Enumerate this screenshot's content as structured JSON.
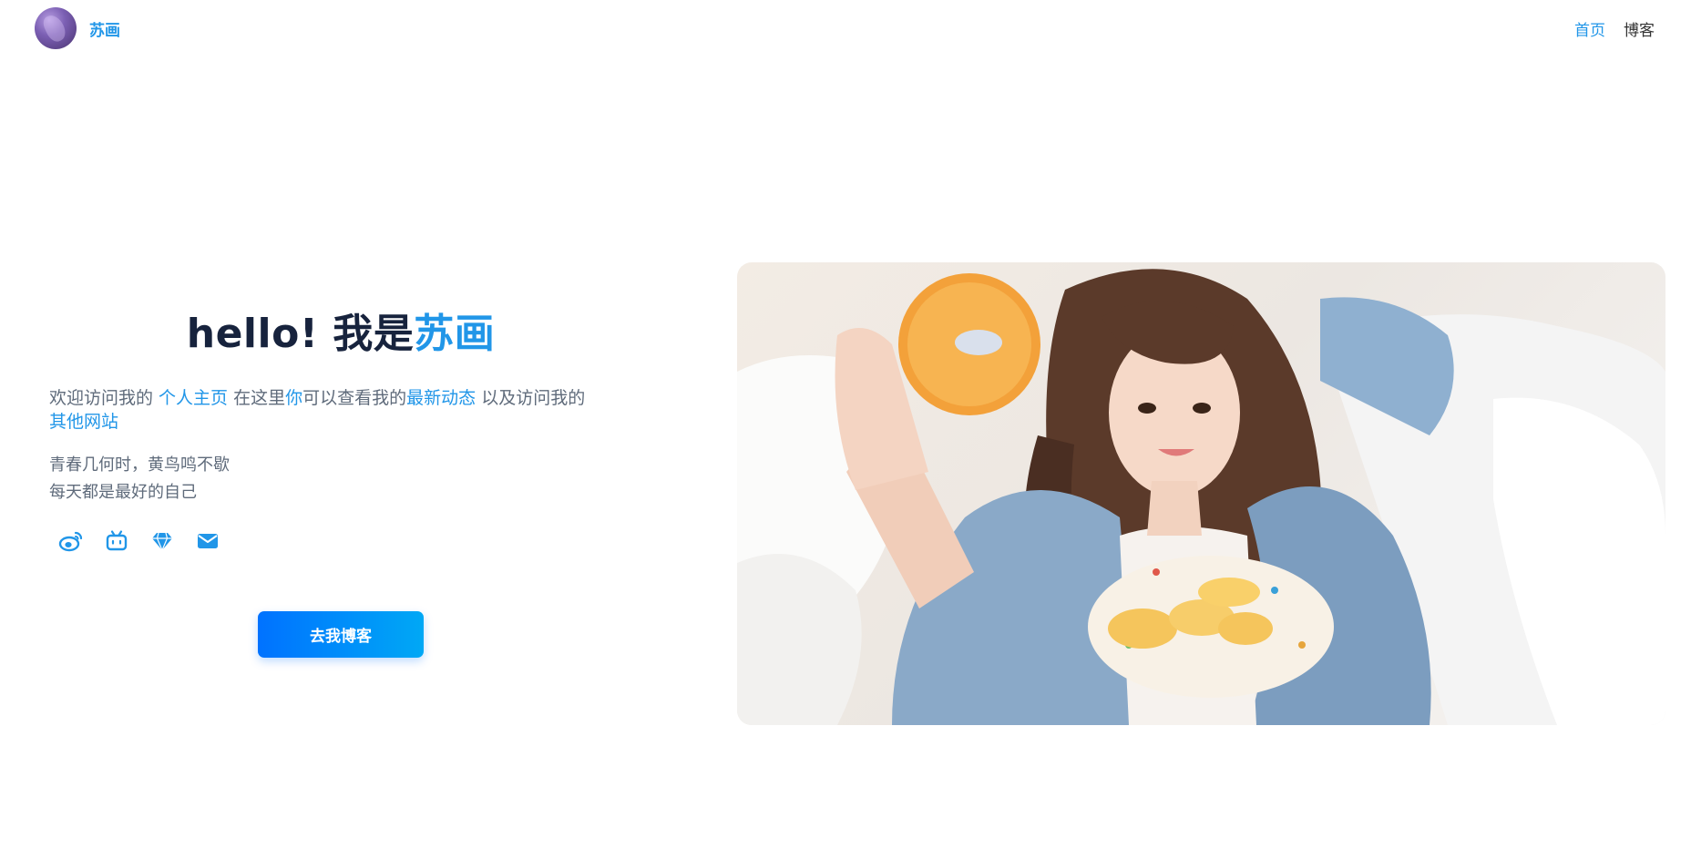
{
  "header": {
    "brand_name": "苏画",
    "nav": [
      {
        "label": "首页",
        "active": true
      },
      {
        "label": "博客",
        "active": false
      }
    ]
  },
  "intro": {
    "hello_prefix": "hello! 我是",
    "hello_name": "苏画",
    "desc": {
      "part1": "欢迎访问我的 ",
      "link1": "个人主页",
      "part2": " 在这里",
      "link2": "你",
      "part3": "可以查看我的",
      "link3": "最新动态",
      "part4": " 以及访问我的",
      "link4": "其他网站"
    },
    "motto_line1": "青春几何时，黄鸟鸣不歇",
    "motto_line2": "每天都是最好的自己"
  },
  "socials": [
    {
      "icon": "weibo-icon"
    },
    {
      "icon": "bilibili-icon"
    },
    {
      "icon": "diamond-icon"
    },
    {
      "icon": "mail-icon"
    }
  ],
  "cta_label": "去我博客",
  "colors": {
    "accent": "#2196e8",
    "heading": "#17233d",
    "body_text": "#5f6b7b",
    "cta_gradient_start": "#0072ff",
    "cta_gradient_end": "#00a8f5"
  }
}
